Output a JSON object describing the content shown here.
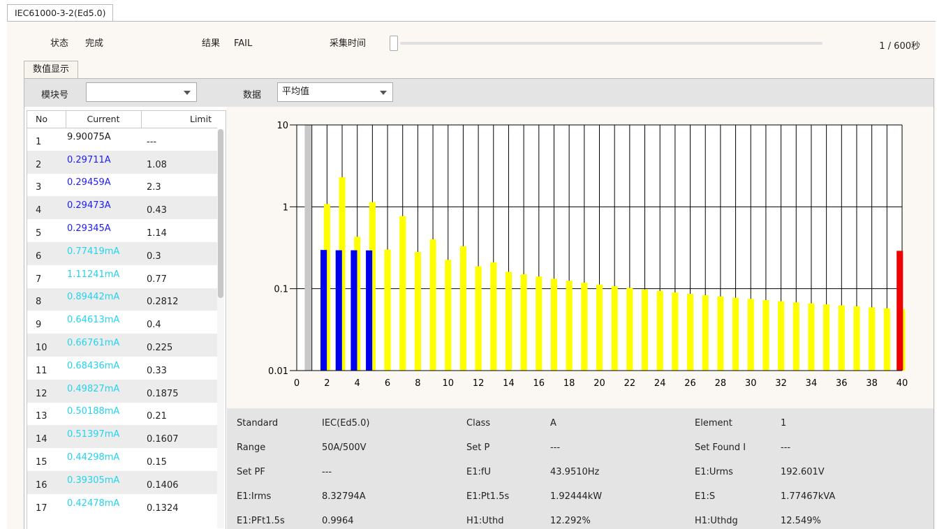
{
  "window": {
    "tab_label": "IEC61000-3-2(Ed5.0)"
  },
  "status_bar": {
    "status_label": "状态",
    "status_value": "完成",
    "result_label": "结果",
    "result_value": "FAIL",
    "collect_label": "采集时间",
    "collect_progress": 0.0017,
    "collect_count": "1 / 600秒"
  },
  "subtab": {
    "label": "数值显示"
  },
  "controls": {
    "module_label": "模块号",
    "module_value": "",
    "data_label": "数据",
    "data_value": "平均值"
  },
  "table": {
    "columns": [
      "No",
      "Current",
      "Limit"
    ],
    "rows": [
      {
        "no": "1",
        "current": "9.90075A",
        "limit": "---",
        "color": "black"
      },
      {
        "no": "2",
        "current": "0.29711A",
        "limit": "1.08",
        "color": "blue"
      },
      {
        "no": "3",
        "current": "0.29459A",
        "limit": "2.3",
        "color": "blue"
      },
      {
        "no": "4",
        "current": "0.29473A",
        "limit": "0.43",
        "color": "blue"
      },
      {
        "no": "5",
        "current": "0.29345A",
        "limit": "1.14",
        "color": "blue"
      },
      {
        "no": "6",
        "current": "0.77419mA",
        "limit": "0.3",
        "color": "cyan"
      },
      {
        "no": "7",
        "current": "1.11241mA",
        "limit": "0.77",
        "color": "cyan"
      },
      {
        "no": "8",
        "current": "0.89442mA",
        "limit": "0.2812",
        "color": "cyan"
      },
      {
        "no": "9",
        "current": "0.64613mA",
        "limit": "0.4",
        "color": "cyan"
      },
      {
        "no": "10",
        "current": "0.66761mA",
        "limit": "0.225",
        "color": "cyan"
      },
      {
        "no": "11",
        "current": "0.68436mA",
        "limit": "0.33",
        "color": "cyan"
      },
      {
        "no": "12",
        "current": "0.49827mA",
        "limit": "0.1875",
        "color": "cyan"
      },
      {
        "no": "13",
        "current": "0.50188mA",
        "limit": "0.21",
        "color": "cyan"
      },
      {
        "no": "14",
        "current": "0.51397mA",
        "limit": "0.1607",
        "color": "cyan"
      },
      {
        "no": "15",
        "current": "0.44298mA",
        "limit": "0.15",
        "color": "cyan"
      },
      {
        "no": "16",
        "current": "0.39305mA",
        "limit": "0.1406",
        "color": "cyan"
      },
      {
        "no": "17",
        "current": "0.42478mA",
        "limit": "0.1324",
        "color": "cyan"
      }
    ]
  },
  "chart_data": {
    "type": "bar",
    "y_scale": "log",
    "ylim": [
      0.01,
      10
    ],
    "xlim": [
      0,
      40
    ],
    "y_ticks": [
      "10",
      "1",
      "0.1",
      "0.01"
    ],
    "x_ticks": [
      "0",
      "2",
      "4",
      "6",
      "8",
      "10",
      "12",
      "14",
      "16",
      "18",
      "20",
      "22",
      "24",
      "26",
      "28",
      "30",
      "32",
      "34",
      "36",
      "38",
      "40"
    ],
    "grid": true,
    "series": [
      {
        "role": "limit",
        "color": "#ffff00",
        "x": [
          2,
          3,
          4,
          5,
          6,
          7,
          8,
          9,
          10,
          11,
          12,
          13,
          14,
          15,
          16,
          17,
          18,
          19,
          20,
          21,
          22,
          23,
          24,
          25,
          26,
          27,
          28,
          29,
          30,
          31,
          32,
          33,
          34,
          35,
          36,
          37,
          38,
          39,
          40
        ],
        "values": [
          1.08,
          2.3,
          0.43,
          1.14,
          0.3,
          0.77,
          0.2812,
          0.4,
          0.225,
          0.33,
          0.1875,
          0.21,
          0.1607,
          0.15,
          0.1406,
          0.1324,
          0.125,
          0.1184,
          0.1125,
          0.1071,
          0.1023,
          0.0978,
          0.0938,
          0.09,
          0.0865,
          0.0833,
          0.0804,
          0.0776,
          0.075,
          0.0726,
          0.0703,
          0.0682,
          0.0662,
          0.0643,
          0.0625,
          0.0608,
          0.0592,
          0.0577,
          0.0563
        ]
      },
      {
        "role": "current",
        "x": [
          1,
          2,
          3,
          4,
          5,
          40
        ],
        "values": [
          9.90075,
          0.29711,
          0.29459,
          0.29473,
          0.29345,
          0.29
        ],
        "colors": [
          "#c8c8c8",
          "#0000ee",
          "#0000ee",
          "#0000ee",
          "#0000ee",
          "#ee0000"
        ]
      }
    ]
  },
  "info": [
    {
      "label": "Standard",
      "value": "IEC(Ed5.0)"
    },
    {
      "label": "Class",
      "value": "A"
    },
    {
      "label": "Element",
      "value": "1"
    },
    {
      "label": "Range",
      "value": "50A/500V"
    },
    {
      "label": "Set P",
      "value": "---"
    },
    {
      "label": "Set Found I",
      "value": "---"
    },
    {
      "label": "Set PF",
      "value": "---"
    },
    {
      "label": "E1:fU",
      "value": "43.9510Hz"
    },
    {
      "label": "E1:Urms",
      "value": "192.601V"
    },
    {
      "label": "E1:Irms",
      "value": "8.32794A"
    },
    {
      "label": "E1:Pt1.5s",
      "value": "1.92444kW"
    },
    {
      "label": "E1:S",
      "value": "1.77467kVA"
    },
    {
      "label": "E1:PFt1.5s",
      "value": "0.9964"
    },
    {
      "label": "H1:Uthd",
      "value": "12.292%"
    },
    {
      "label": "H1:Uthdg",
      "value": "12.549%"
    }
  ]
}
